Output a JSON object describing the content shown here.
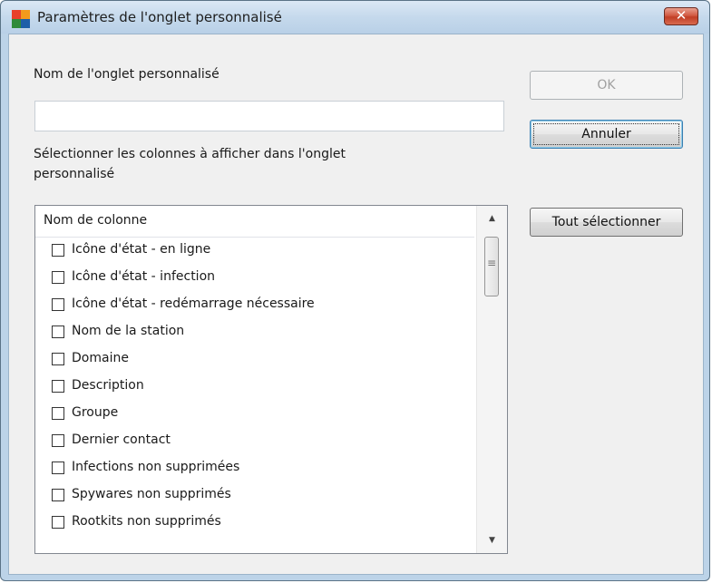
{
  "window": {
    "title": "Paramètres de l'onglet personnalisé",
    "close_label": "✕"
  },
  "form": {
    "name_label": "Nom de l'onglet personnalisé",
    "name_value": "",
    "columns_label_line1": "Sélectionner les colonnes à afficher dans l'onglet",
    "columns_label_line2": "personnalisé"
  },
  "buttons": {
    "ok": "OK",
    "cancel": "Annuler",
    "select_all": "Tout sélectionner"
  },
  "list": {
    "header": "Nom de colonne",
    "items": [
      {
        "label": "Icône d'état - en ligne",
        "checked": false
      },
      {
        "label": "Icône d'état - infection",
        "checked": false
      },
      {
        "label": "Icône d'état - redémarrage nécessaire",
        "checked": false
      },
      {
        "label": "Nom de la station",
        "checked": false
      },
      {
        "label": "Domaine",
        "checked": false
      },
      {
        "label": "Description",
        "checked": false
      },
      {
        "label": "Groupe",
        "checked": false
      },
      {
        "label": "Dernier contact",
        "checked": false
      },
      {
        "label": "Infections non supprimées",
        "checked": false
      },
      {
        "label": "Spywares non supprimés",
        "checked": false
      },
      {
        "label": "Rootkits non supprimés",
        "checked": false
      }
    ]
  },
  "scrollbar": {
    "up_glyph": "▲",
    "down_glyph": "▼",
    "grip_glyph": "≡"
  },
  "icons": {
    "app": "avg-app-icon",
    "close": "close-icon"
  }
}
